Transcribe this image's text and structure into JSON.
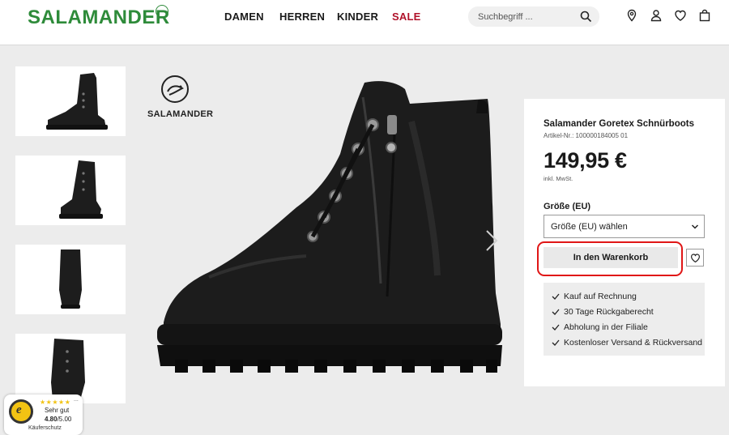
{
  "header": {
    "logo": "SALAMANDER",
    "nav": [
      {
        "label": "DAMEN"
      },
      {
        "label": "HERREN"
      },
      {
        "label": "KINDER"
      },
      {
        "label": "SALE"
      }
    ],
    "search": {
      "placeholder": "Suchbegriff ..."
    },
    "icons": [
      "location-icon",
      "account-icon",
      "wishlist-icon",
      "cart-icon"
    ]
  },
  "gallery": {
    "thumbnails": [
      "thumbnail-1",
      "thumbnail-2",
      "thumbnail-3",
      "thumbnail-4"
    ],
    "brand_badge": "SALAMANDER"
  },
  "product": {
    "title": "Salamander Goretex Schnürboots",
    "article_no": "Artikel-Nr.: 100000184005 01",
    "price": "149,95 €",
    "vat_note": "inkl. MwSt.",
    "size_label": "Größe (EU)",
    "size_select": "Größe (EU) wählen",
    "cart_button": "In den Warenkorb",
    "benefits": [
      "Kauf auf Rechnung",
      "30 Tage Rückgaberecht",
      "Abholung in der Filiale",
      "Kostenloser Versand & Rückversand"
    ]
  },
  "trust_badge": {
    "rating_text": "Sehr gut",
    "score": "4.80",
    "max": "/5.00",
    "stars": "★★★★★",
    "label": "Käuferschutz",
    "more": "..."
  },
  "colors": {
    "brand_green": "#2e8b3a",
    "sale_red": "#b0122a",
    "highlight_red": "#e01616"
  }
}
